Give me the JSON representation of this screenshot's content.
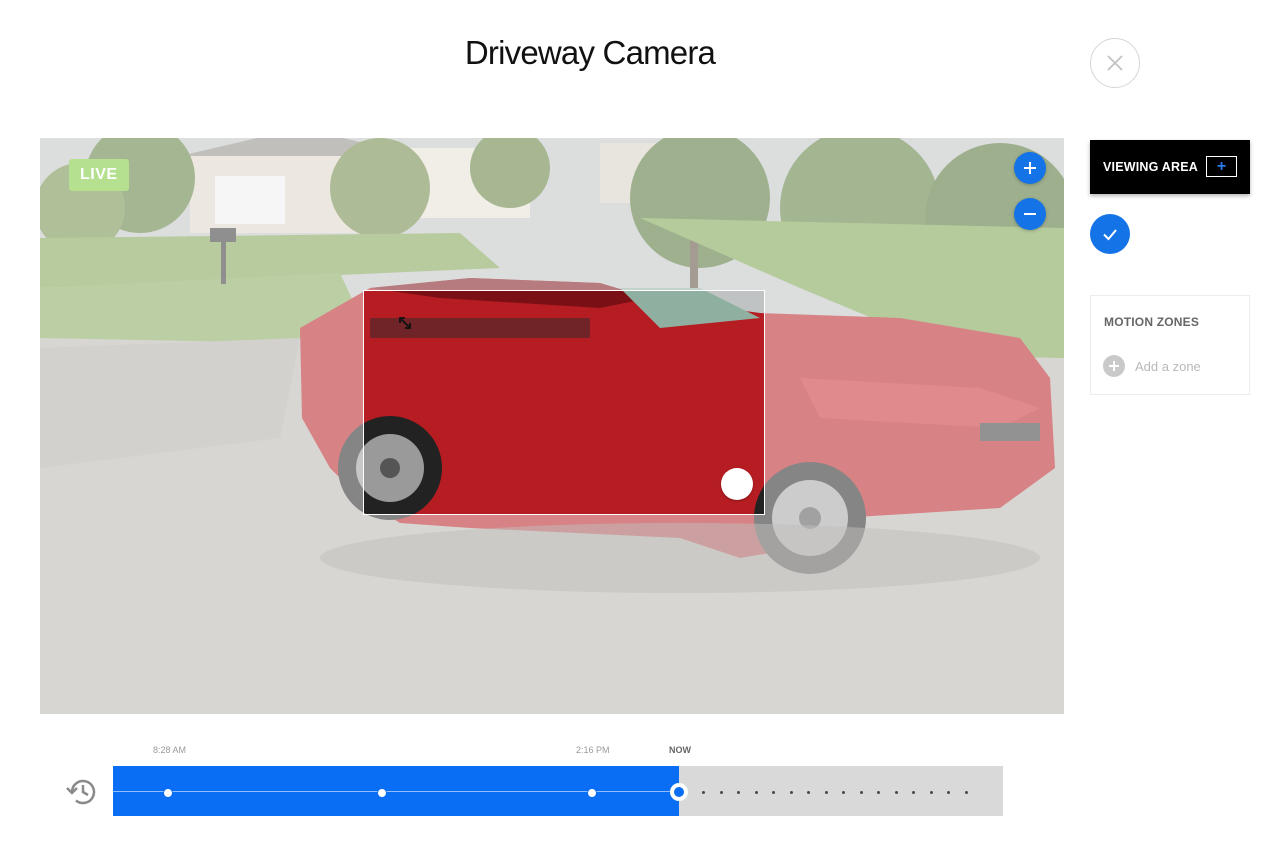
{
  "page": {
    "title": "Driveway Camera",
    "close_icon": "close-icon"
  },
  "player": {
    "live_label": "LIVE",
    "zoom_in_icon": "plus-icon",
    "zoom_out_icon": "minus-icon",
    "resize_icon": "resize-diagonal-icon"
  },
  "sidebar": {
    "viewing_area_label": "VIEWING AREA",
    "viewing_area_add": "+",
    "confirm_icon": "checkmark-icon",
    "motion_zones_title": "MOTION ZONES",
    "add_zone_label": "Add a zone"
  },
  "timeline": {
    "history_icon": "history-icon",
    "labels": [
      "8:28 AM",
      "2:16 PM",
      "NOW"
    ],
    "progress_fraction": 0.636,
    "event_count": 4,
    "colors": {
      "progress": "#0a6ef5",
      "track": "#d9d9d9"
    }
  },
  "colors": {
    "accent": "#1473e6",
    "live_badge": "#b4e08f",
    "viewing_area_bg": "#000000"
  }
}
